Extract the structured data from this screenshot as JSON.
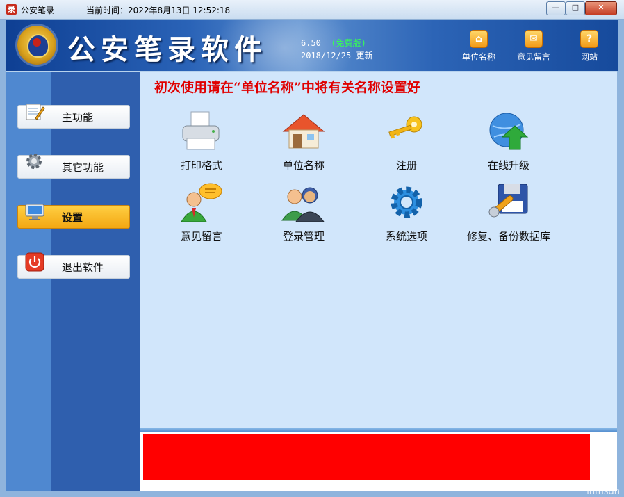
{
  "window": {
    "title": "公安笔录",
    "clock_label": "当前时间：2022年8月13日 12:52:18",
    "controls": {
      "minimize": "—",
      "maximize": "□",
      "close": "✕"
    }
  },
  "banner": {
    "logo_title": "公安笔录软件",
    "version": "6.50",
    "edition": "(免费版)",
    "update": "2018/12/25 更新",
    "links": [
      {
        "label": "单位名称",
        "icon": "home-icon",
        "glyph": "⌂"
      },
      {
        "label": "意见留言",
        "icon": "envelope-icon",
        "glyph": "✉"
      },
      {
        "label": "网站",
        "icon": "help-icon",
        "glyph": "?"
      }
    ]
  },
  "sidebar": {
    "items": [
      {
        "label": "主功能",
        "icon": "notepad-icon",
        "active": false
      },
      {
        "label": "其它功能",
        "icon": "gear-icon",
        "active": false
      },
      {
        "label": "设置",
        "icon": "monitor-icon",
        "active": true
      },
      {
        "label": "退出软件",
        "icon": "power-icon",
        "active": false
      }
    ]
  },
  "main": {
    "notice": "初次使用请在“单位名称”中将有关名称设置好",
    "functions": [
      {
        "label": "打印格式",
        "icon": "printer-icon"
      },
      {
        "label": "单位名称",
        "icon": "house-icon"
      },
      {
        "label": "注册",
        "icon": "keys-icon"
      },
      {
        "label": "在线升级",
        "icon": "globe-upload-icon"
      },
      {
        "label": "意见留言",
        "icon": "user-speech-icon"
      },
      {
        "label": "登录管理",
        "icon": "users-icon"
      },
      {
        "label": "系统选项",
        "icon": "cog-icon"
      },
      {
        "label": "修复、备份数据库",
        "icon": "floppy-wrench-icon"
      }
    ]
  },
  "footer": {
    "watermark": "inmsdn"
  },
  "colors": {
    "notice": "#e00000",
    "active_tab": "#f6b21c",
    "banner": "#1d56aa",
    "footer_bar": "#ff0000"
  }
}
